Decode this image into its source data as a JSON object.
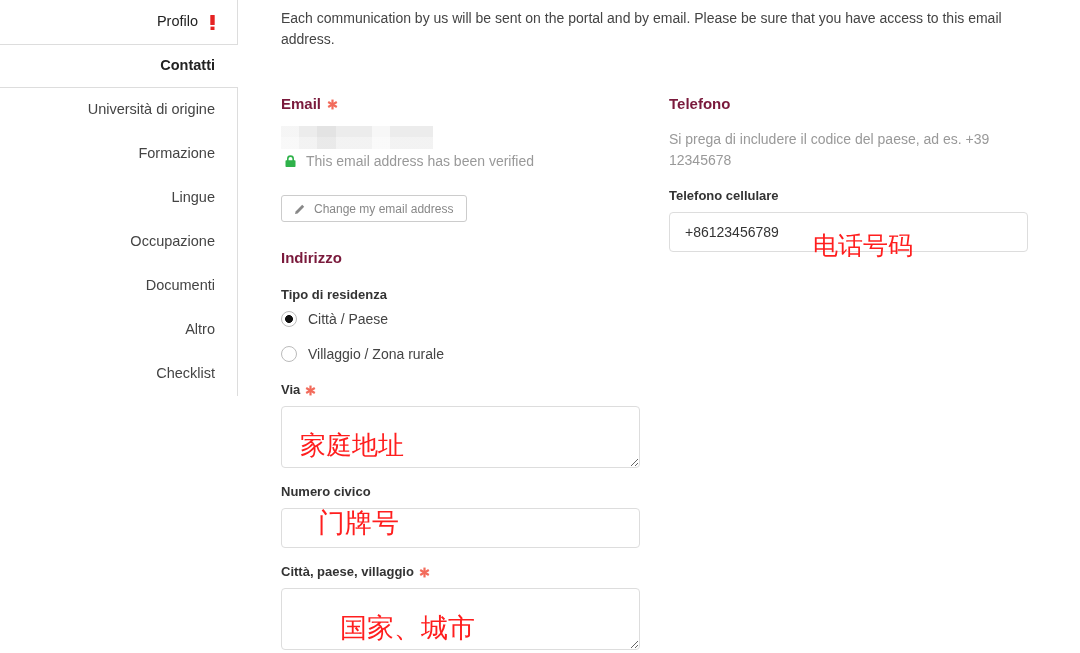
{
  "sidebar": {
    "items": [
      {
        "label": "Profilo",
        "selected": false,
        "warning": true
      },
      {
        "label": "Contatti",
        "selected": true,
        "warning": false
      },
      {
        "label": "Università di origine",
        "selected": false,
        "warning": false
      },
      {
        "label": "Formazione",
        "selected": false,
        "warning": false
      },
      {
        "label": "Lingue",
        "selected": false,
        "warning": false
      },
      {
        "label": "Occupazione",
        "selected": false,
        "warning": false
      },
      {
        "label": "Documenti",
        "selected": false,
        "warning": false
      },
      {
        "label": "Altro",
        "selected": false,
        "warning": false
      },
      {
        "label": "Checklist",
        "selected": false,
        "warning": false
      }
    ]
  },
  "intro": "Each communication by us will be sent on the portal and by email. Please be sure that you have access to this email address.",
  "email": {
    "heading": "Email",
    "required": true,
    "verified": true,
    "verified_text": "This email address has been verified",
    "change_button": "Change my email address"
  },
  "address": {
    "heading": "Indirizzo",
    "residence_type": {
      "label": "Tipo di residenza",
      "options": [
        {
          "label": "Città / Paese",
          "selected": true
        },
        {
          "label": "Villaggio / Zona rurale",
          "selected": false
        }
      ]
    },
    "fields": [
      {
        "label": "Via",
        "required": true,
        "kind": "textarea",
        "annotation": "家庭地址"
      },
      {
        "label": "Numero civico",
        "required": false,
        "kind": "input",
        "annotation": "门牌号"
      },
      {
        "label": "Città, paese, villaggio",
        "required": true,
        "kind": "textarea",
        "annotation": "国家、城市"
      }
    ]
  },
  "phone": {
    "heading": "Telefono",
    "help": "Si prega di includere il codice del paese, ad es. +39 12345678",
    "fields": [
      {
        "label": "Telefono cellulare",
        "required": false,
        "kind": "input",
        "value": "+86123456789",
        "annotation": "电话号码"
      }
    ]
  }
}
